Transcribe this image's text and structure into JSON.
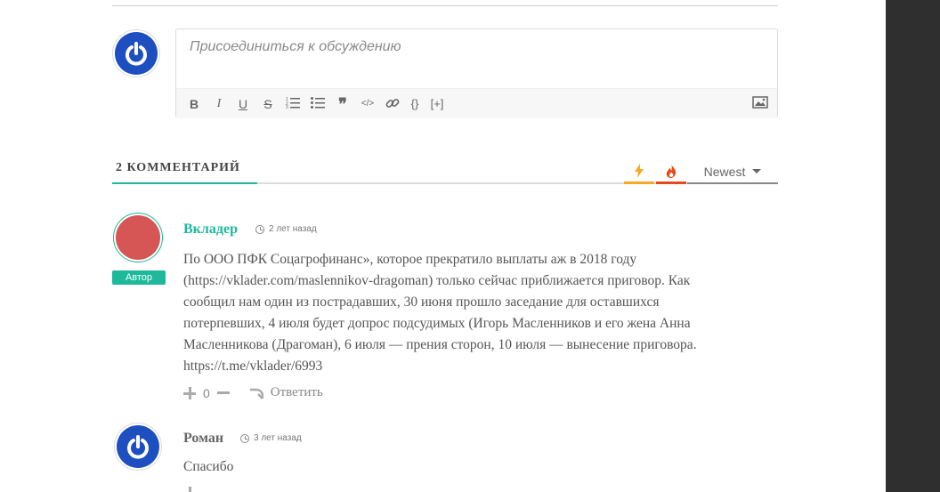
{
  "editor": {
    "placeholder": "Присоединиться к обсуждению",
    "toolbar": [
      "bold",
      "italic",
      "underline",
      "strikethrough",
      "ordered-list",
      "bullet-list",
      "blockquote",
      "code",
      "link",
      "source-code",
      "spoiler",
      "image"
    ],
    "spoiler_label": "[+]",
    "source_label": "{}"
  },
  "comments_header": {
    "title": "2 КОММЕНТАРИЙ",
    "sort_label": "Newest",
    "filter_icons": [
      "bolt-icon",
      "fire-icon"
    ],
    "colors": {
      "accent": "#1db99a",
      "bolt": "#f9a825",
      "fire": "#e64a19"
    }
  },
  "comments": [
    {
      "author": "Вкладер",
      "time": "2 лет назад",
      "badge": "Автор",
      "lines": [
        "По ООО ПФК Соцагрофинанс», которое прекратило выплаты аж в 2018 году",
        "(https://vklader.com/maslennikov-dragoman) только сейчас приближается приговор. Как",
        "сообщил нам один из пострадавших, 30 июня прошло заседание для оставшихся",
        "потерпевших, 4 июля будет допрос подсудимых (Игорь Масленников и его жена Анна",
        "Масленникова (Драгоман), 6 июля — прения сторон, 10 июля — вынесение приговора.",
        "https://t.me/vklader/6993"
      ],
      "votes": "0",
      "reply_label": "Ответить",
      "avatar_color": "#d65656"
    },
    {
      "author": "Роман",
      "time": "3 лет назад",
      "text": "Спасибо"
    }
  ]
}
